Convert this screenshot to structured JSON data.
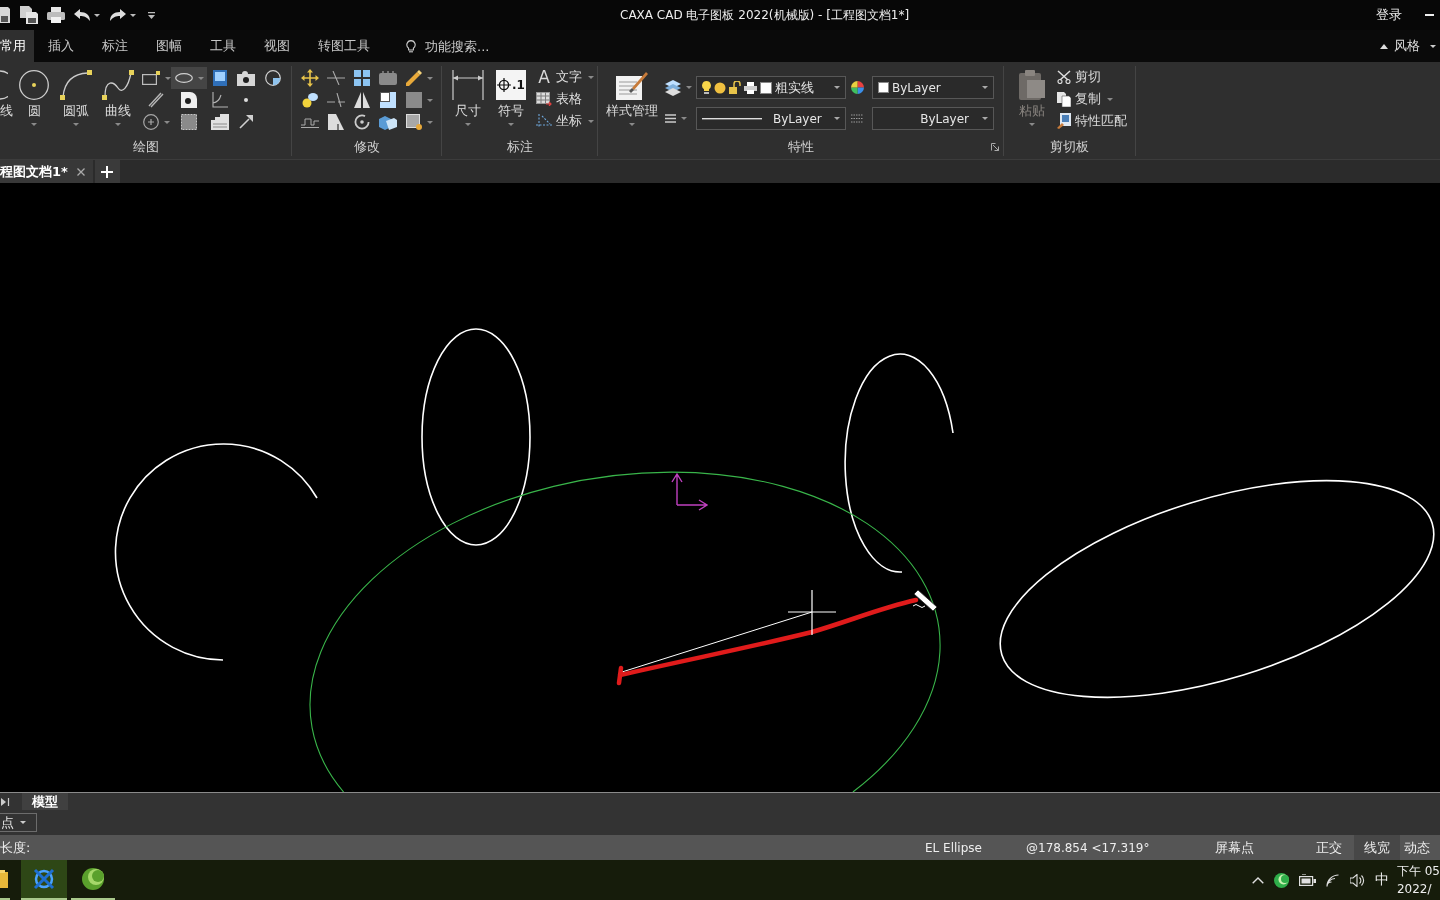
{
  "title_bar": {
    "title": "CAXA CAD 电子图板 2022(机械版) - [工程图文档1*]",
    "login": "登录"
  },
  "ribbon_tabs": [
    {
      "label": "常用",
      "selected": true
    },
    {
      "label": "插入",
      "selected": false
    },
    {
      "label": "标注",
      "selected": false
    },
    {
      "label": "图幅",
      "selected": false
    },
    {
      "label": "工具",
      "selected": false
    },
    {
      "label": "视图",
      "selected": false
    },
    {
      "label": "转图工具",
      "selected": false
    }
  ],
  "feature_search": {
    "placeholder": "功能搜索..."
  },
  "style_menu": {
    "label": "风格"
  },
  "ribbon": {
    "draw": {
      "label": "绘图",
      "buttons": [
        {
          "label": "线"
        },
        {
          "label": "圆"
        },
        {
          "label": "圆弧"
        },
        {
          "label": "曲线"
        }
      ],
      "tools": [
        {
          "selected": false
        },
        {
          "selected": true
        },
        {
          "selected": false
        },
        {
          "selected": false
        },
        {
          "selected": false
        },
        {
          "selected": false
        },
        {
          "selected": false
        },
        {
          "selected": false
        },
        {
          "selected": false
        },
        {
          "selected": false
        },
        {
          "selected": false
        },
        {
          "selected": false
        },
        {
          "selected": false
        }
      ]
    },
    "modify": {
      "label": "修改"
    },
    "annotate": {
      "label": "标注",
      "buttons": [
        {
          "label": "尺寸"
        },
        {
          "label": "符号",
          "icon_text": ".1"
        }
      ],
      "small_buttons": [
        {
          "icon_text": "A",
          "label": "文字"
        },
        {
          "label": "表格"
        },
        {
          "label": "坐标"
        }
      ]
    },
    "properties": {
      "label": "特性",
      "style_button": {
        "label": "样式管理"
      },
      "layer": {
        "value": "粗实线"
      },
      "color": {
        "value": "ByLayer"
      },
      "linetype": {
        "value": "ByLayer"
      },
      "linewidth": {
        "value": "ByLayer"
      }
    },
    "clipboard": {
      "label": "剪切板",
      "paste": {
        "label": "粘贴",
        "disabled": true
      },
      "small_buttons": [
        {
          "label": "剪切",
          "disabled": false
        },
        {
          "label": "复制",
          "disabled": false
        },
        {
          "label": "特性匹配",
          "disabled": false
        }
      ]
    }
  },
  "document_tabs": [
    {
      "label": "程图文档1*",
      "selected": true
    }
  ],
  "layout_tabs": [
    {
      "label": "模型",
      "selected": true
    }
  ],
  "command_bar": {
    "point_mode": "点"
  },
  "status_bar": {
    "prompt": "长度:",
    "command": "EL Ellipse",
    "coordinates": "@178.854 <17.319°",
    "snap_mode": "屏幕点",
    "toggles": [
      {
        "label": "正交",
        "on": false
      },
      {
        "label": "线宽",
        "on": true
      },
      {
        "label": "动态",
        "on": false
      }
    ]
  },
  "taskbar": {
    "apps": [
      {
        "active": false
      },
      {
        "active": true
      },
      {
        "active": false
      }
    ],
    "ime": "中",
    "time": "下午 05",
    "date": "2022/"
  }
}
